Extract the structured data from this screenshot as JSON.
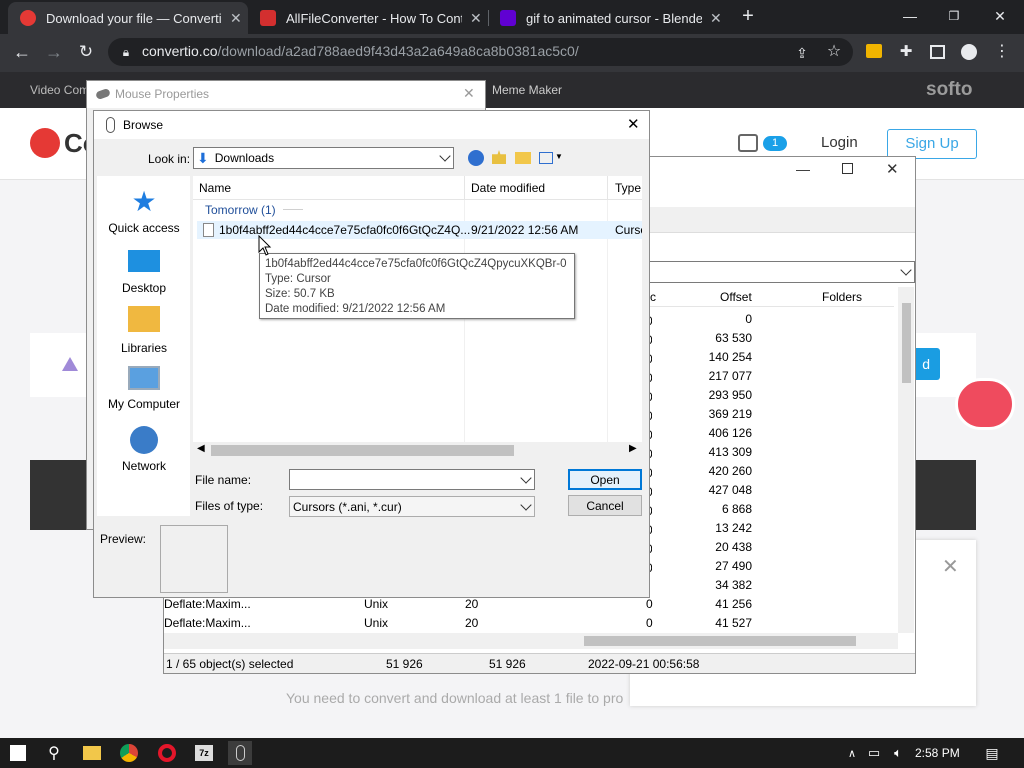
{
  "browser": {
    "tabs": [
      {
        "title": "Download your file — Convertio",
        "color": "#e53935"
      },
      {
        "title": "AllFileConverter - How To Contro",
        "color": "#d32f2f"
      },
      {
        "title": "gif to animated cursor - Blender",
        "color": "#6001d2"
      }
    ],
    "url_domain": "convertio.co",
    "url_path": "/download/a2ad788aed9f43d43a2a649a8ca8b0381ac5c0/"
  },
  "site": {
    "nav_left": "Video Com",
    "nav_meme": "Meme Maker",
    "brand_right": "softo",
    "logo_text": "Co",
    "badge_count": "1",
    "login": "Login",
    "signup": "Sign Up",
    "upload_btn_text": "d",
    "bottom_note": "You need to convert and download at least 1 file to pro"
  },
  "archive": {
    "columns": {
      "offset": "Offset",
      "folders": "Folders",
      "c": "c"
    },
    "offsets": [
      "0",
      "63 530",
      "140 254",
      "217 077",
      "293 950",
      "369 219",
      "406 126",
      "413 309",
      "420 260",
      "427 048",
      "6 868",
      "13 242",
      "20 438",
      "27 490",
      "34 382",
      "41 256",
      "41 527"
    ],
    "rows": [
      {
        "method": "Deflate:Maxim...",
        "host": "Unix",
        "ver": "20",
        "c": "0"
      },
      {
        "method": "Deflate:Maxim...",
        "host": "Unix",
        "ver": "20",
        "c": "0"
      }
    ],
    "status": {
      "selected": "1 / 65 object(s) selected",
      "size": "51 926",
      "packed": "51 926",
      "date": "2022-09-21 00:56:58"
    }
  },
  "mouse_props": {
    "title": "Mouse Properties"
  },
  "browse": {
    "title": "Browse",
    "look_in_label": "Look in:",
    "look_in_value": "Downloads",
    "places": [
      {
        "label": "Quick access"
      },
      {
        "label": "Desktop"
      },
      {
        "label": "Libraries"
      },
      {
        "label": "My Computer"
      },
      {
        "label": "Network"
      }
    ],
    "columns": {
      "name": "Name",
      "date": "Date modified",
      "type": "Type"
    },
    "group": "Tomorrow (1)",
    "file": {
      "name": "1b0f4abff2ed44c4cce7e75cfa0fc0f6GtQcZ4Q...",
      "date": "9/21/2022 12:56 AM",
      "type": "Curso"
    },
    "tooltip": {
      "name": "1b0f4abff2ed44c4cce7e75cfa0fc0f6GtQcZ4QpycuXKQBr-0",
      "type": "Type: Cursor",
      "size": "Size: 50.7 KB",
      "date": "Date modified: 9/21/2022 12:56 AM"
    },
    "file_name_label": "File name:",
    "file_name_value": "",
    "files_of_type_label": "Files of type:",
    "files_of_type_value": "Cursors (*.ani, *.cur)",
    "open": "Open",
    "cancel": "Cancel",
    "preview": "Preview:"
  },
  "taskbar": {
    "time": "2:58 PM"
  }
}
